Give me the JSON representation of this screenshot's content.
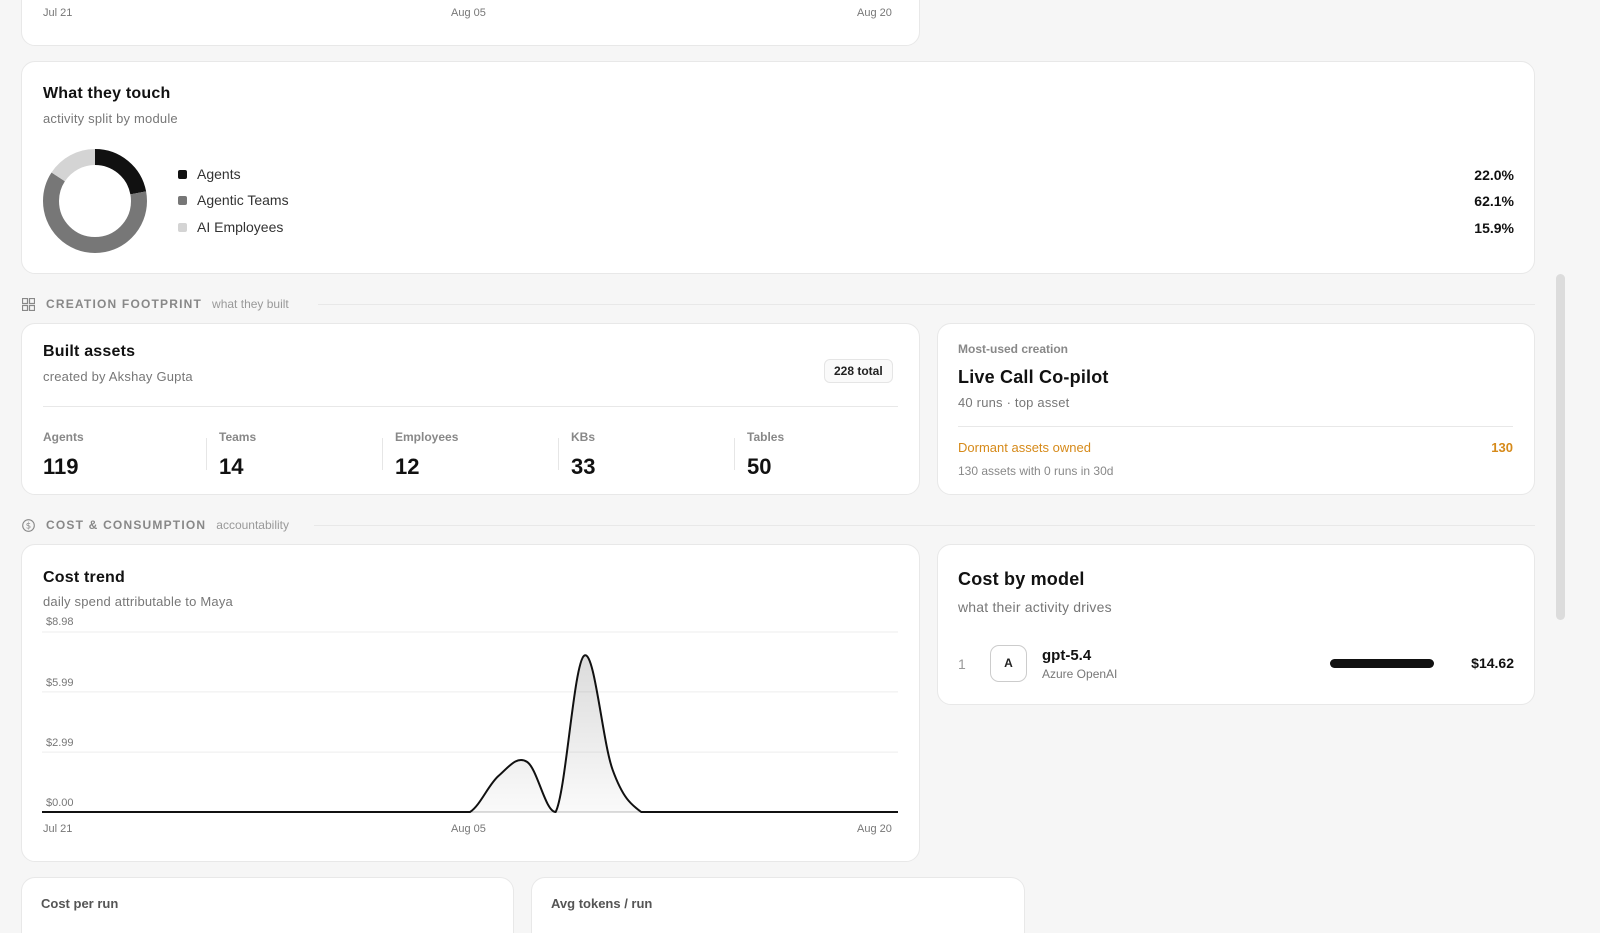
{
  "top_chart": {
    "x_labels": [
      "Jul 21",
      "Aug 05",
      "Aug 20"
    ]
  },
  "module_split": {
    "title": "What they touch",
    "subtitle": "activity split by module",
    "items": [
      {
        "label": "Agents",
        "pct": 22.0,
        "pct_label": "22.0%",
        "color": "#111111"
      },
      {
        "label": "Agentic Teams",
        "pct": 62.1,
        "pct_label": "62.1%",
        "color": "#777777"
      },
      {
        "label": "AI Employees",
        "pct": 15.9,
        "pct_label": "15.9%",
        "color": "#d4d4d4"
      }
    ]
  },
  "creation_section": {
    "title": "CREATION FOOTPRINT",
    "subtitle": "what they built",
    "icon": "grid-icon"
  },
  "built_assets": {
    "title": "Built assets",
    "subtitle": "created by Akshay Gupta",
    "total_badge": "228 total",
    "stats": [
      {
        "label": "Agents",
        "value": "119"
      },
      {
        "label": "Teams",
        "value": "14"
      },
      {
        "label": "Employees",
        "value": "12"
      },
      {
        "label": "KBs",
        "value": "33"
      },
      {
        "label": "Tables",
        "value": "50"
      }
    ]
  },
  "most_used": {
    "label": "Most-used creation",
    "name": "Live Call Co-pilot",
    "meta": "40 runs · top asset",
    "dormant_label": "Dormant assets owned",
    "dormant_value": "130",
    "dormant_note": "130 assets with 0 runs in 30d",
    "accent": "#d68a1a"
  },
  "cost_section": {
    "title": "COST & CONSUMPTION",
    "subtitle": "accountability",
    "icon": "dollar-circle-icon"
  },
  "cost_trend": {
    "title": "Cost trend",
    "subtitle": "daily spend attributable to Maya",
    "y_labels": [
      "$8.98",
      "$5.99",
      "$2.99",
      "$0.00"
    ],
    "x_labels": [
      "Jul 21",
      "Aug 05",
      "Aug 20"
    ]
  },
  "chart_data": {
    "type": "area",
    "title": "Cost trend",
    "x": [
      "Jul 21",
      "Jul 22",
      "Jul 23",
      "Jul 24",
      "Jul 25",
      "Jul 26",
      "Jul 27",
      "Jul 28",
      "Jul 29",
      "Jul 30",
      "Jul 31",
      "Aug 01",
      "Aug 02",
      "Aug 03",
      "Aug 04",
      "Aug 05",
      "Aug 06",
      "Aug 07",
      "Aug 08",
      "Aug 09",
      "Aug 10",
      "Aug 11",
      "Aug 12",
      "Aug 13",
      "Aug 14",
      "Aug 15",
      "Aug 16",
      "Aug 17",
      "Aug 18",
      "Aug 19",
      "Aug 20"
    ],
    "values": [
      0,
      0,
      0,
      0,
      0,
      0,
      0,
      0,
      0,
      0,
      0,
      0,
      0,
      0,
      0,
      0,
      1.8,
      2.5,
      0,
      7.8,
      2.1,
      0,
      0,
      0,
      0,
      0,
      0,
      0,
      0,
      0,
      0
    ],
    "y_ticks": [
      "$8.98",
      "$5.99",
      "$2.99",
      "$0.00"
    ],
    "ylim": [
      0,
      8.98
    ],
    "grid": true
  },
  "cost_by_model": {
    "title": "Cost by model",
    "subtitle": "what their activity drives",
    "rows": [
      {
        "rank": "1",
        "badge": "A",
        "model": "gpt-5.4",
        "provider": "Azure OpenAI",
        "share": 1.0,
        "cost": "$14.62"
      }
    ]
  },
  "bottom_cards": {
    "cost_per_run": "Cost per run",
    "avg_tokens": "Avg tokens / run"
  }
}
